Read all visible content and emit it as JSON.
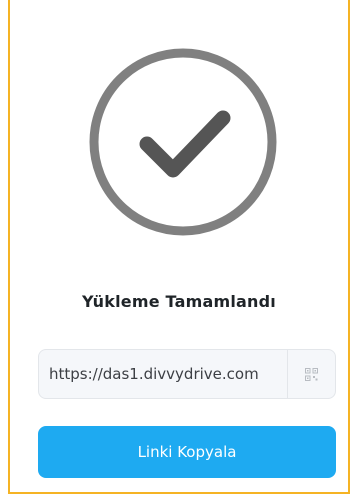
{
  "status": {
    "title": "Yükleme Tamamlandı",
    "icon": "check-circle-icon",
    "icon_color": "#808080",
    "check_color": "#555555"
  },
  "link": {
    "value": "https://das1.divvydrive.com",
    "qr_icon": "qr-code-icon"
  },
  "actions": {
    "copy_label": "Linki Kopyala",
    "copy_color": "#1eaaf1"
  },
  "accent_border_color": "#f5b324"
}
